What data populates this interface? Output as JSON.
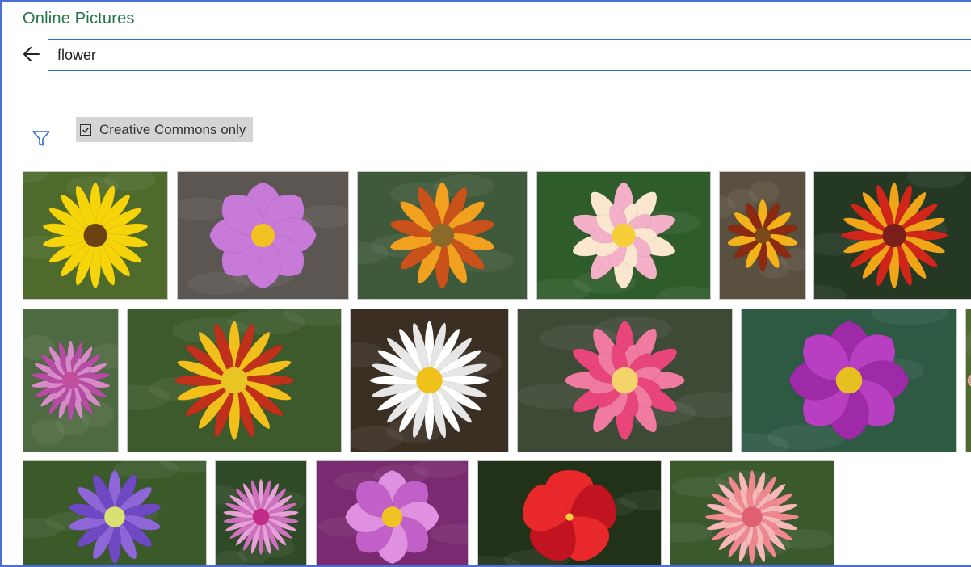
{
  "window": {
    "title": "Online Pictures"
  },
  "search": {
    "value": "flower",
    "back_icon": "back-arrow-icon"
  },
  "filter": {
    "icon": "filter-icon",
    "creative_commons_label": "Creative Commons only",
    "creative_commons_checked": true
  },
  "images": [
    {
      "name": "yellow-sunflower",
      "bg": "#4e6b2c",
      "petal": "#f6d40a",
      "petal2": "#f6d40a",
      "center": "#6b4312",
      "petals": 18,
      "shape": "daisy"
    },
    {
      "name": "pink-cosmos",
      "bg": "#5b5651",
      "petal": "#c77ad8",
      "petal2": "#c77ad8",
      "center": "#f1c221",
      "petals": 8,
      "shape": "cosmos"
    },
    {
      "name": "orange-gazania",
      "bg": "#3f5a3a",
      "petal": "#f2a020",
      "petal2": "#c9521a",
      "center": "#8a6a2a",
      "petals": 14,
      "shape": "daisy"
    },
    {
      "name": "pink-lotus",
      "bg": "#2e5c2a",
      "petal": "#f3b0c8",
      "petal2": "#fbe7cf",
      "center": "#f4cf3a",
      "petals": 10,
      "shape": "lotus"
    },
    {
      "name": "striped-gazania",
      "bg": "#5a5040",
      "petal": "#f3b21a",
      "petal2": "#8b2a10",
      "center": "#7a4a1a",
      "petals": 14,
      "shape": "daisy"
    },
    {
      "name": "red-yellow-zinnia",
      "bg": "#243824",
      "petal": "#f0a418",
      "petal2": "#d0261a",
      "center": "#7a1e1a",
      "petals": 20,
      "shape": "daisy"
    },
    {
      "name": "pink-dahlia-small",
      "bg": "#4e6a40",
      "petal": "#d98ac8",
      "petal2": "#b64ca5",
      "center": "#c04fa0",
      "petals": 22,
      "shape": "dahlia"
    },
    {
      "name": "red-yellow-gazania",
      "bg": "#3c5a2c",
      "petal": "#f2c01a",
      "petal2": "#c0301a",
      "center": "#e8c424",
      "petals": 20,
      "shape": "daisy"
    },
    {
      "name": "white-daisy",
      "bg": "#3b2f24",
      "petal": "#ffffff",
      "petal2": "#e6e6e6",
      "center": "#efc11a",
      "petals": 24,
      "shape": "daisy"
    },
    {
      "name": "pink-camellia",
      "bg": "#3d4a36",
      "petal": "#e8457a",
      "petal2": "#f07aa0",
      "center": "#f3d36a",
      "petals": 12,
      "shape": "camellia"
    },
    {
      "name": "purple-cosmos",
      "bg": "#2e5a44",
      "petal": "#9e2aa8",
      "petal2": "#b83fc2",
      "center": "#e6c020",
      "petals": 8,
      "shape": "cosmos"
    },
    {
      "name": "pink-dahlia",
      "bg": "#4c6c2e",
      "petal": "#f2a090",
      "petal2": "#f6c0b0",
      "center": "#e8b050",
      "petals": 24,
      "shape": "dahlia"
    },
    {
      "name": "blue-anemone",
      "bg": "#3a5a2a",
      "petal": "#8e66d8",
      "petal2": "#6f48c4",
      "center": "#d8e070",
      "petals": 14,
      "shape": "daisy"
    },
    {
      "name": "pink-gerbera",
      "bg": "#2f4a26",
      "petal": "#e8a0d8",
      "petal2": "#d070c0",
      "center": "#c02a88",
      "petals": 26,
      "shape": "daisy"
    },
    {
      "name": "cosmos-field",
      "bg": "#7a2a70",
      "petal": "#e090e0",
      "petal2": "#c060c8",
      "center": "#f1c221",
      "petals": 8,
      "shape": "cosmos"
    },
    {
      "name": "red-hibiscus",
      "bg": "#213218",
      "petal": "#e8282a",
      "petal2": "#c21420",
      "center": "#f6d040",
      "petals": 5,
      "shape": "hibiscus"
    },
    {
      "name": "coral-dahlia",
      "bg": "#3a5a2e",
      "petal": "#f08890",
      "petal2": "#f8b8b8",
      "center": "#e06070",
      "petals": 24,
      "shape": "dahlia"
    }
  ]
}
